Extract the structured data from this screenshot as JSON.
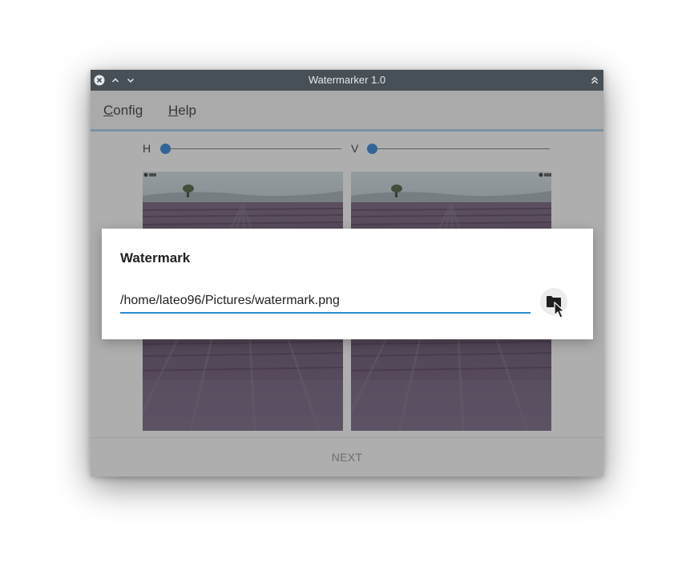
{
  "window": {
    "title": "Watermarker 1.0"
  },
  "menu": {
    "config": {
      "accel": "C",
      "rest": "onfig"
    },
    "help": {
      "accel": "H",
      "rest": "elp"
    }
  },
  "sliders": {
    "h_label": "H",
    "v_label": "V",
    "h_value": 0,
    "v_value": 0
  },
  "footer": {
    "next_label": "NEXT"
  },
  "dialog": {
    "title": "Watermark",
    "path_value": "/home/lateo96/Pictures/watermark.png"
  },
  "icons": {
    "close": "close-icon",
    "minimize": "chevron-up-icon",
    "maximize": "chevron-down-icon",
    "keep_above": "double-chevron-up-icon",
    "browse": "folder-icon"
  },
  "colors": {
    "accent": "#2a8ad0",
    "titlebar": "#475057"
  }
}
